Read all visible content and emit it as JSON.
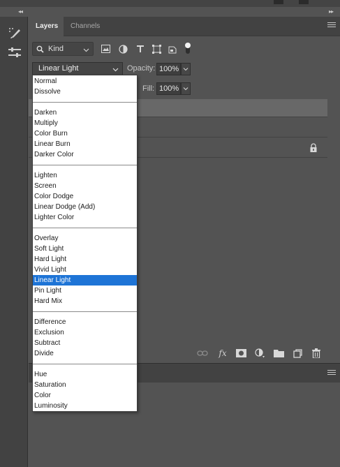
{
  "panel": {
    "tabs": [
      {
        "label": "Layers",
        "active": true
      },
      {
        "label": "Channels",
        "active": false
      }
    ]
  },
  "filter": {
    "kind_label": "Kind",
    "icons": [
      "pixel-filter-icon",
      "adjustment-filter-icon",
      "type-filter-icon",
      "shape-filter-icon",
      "smart-object-filter-icon",
      "filter-toggle-icon"
    ]
  },
  "blend": {
    "current_mode": "Linear Light",
    "opacity_label": "Opacity:",
    "opacity_value": "100%",
    "fill_label": "Fill:",
    "fill_value": "100%"
  },
  "blend_menu": {
    "groups": [
      [
        "Normal",
        "Dissolve"
      ],
      [
        "Darken",
        "Multiply",
        "Color Burn",
        "Linear Burn",
        "Darker Color"
      ],
      [
        "Lighten",
        "Screen",
        "Color Dodge",
        "Linear Dodge (Add)",
        "Lighter Color"
      ],
      [
        "Overlay",
        "Soft Light",
        "Hard Light",
        "Vivid Light",
        "Linear Light",
        "Pin Light",
        "Hard Mix"
      ],
      [
        "Difference",
        "Exclusion",
        "Subtract",
        "Divide"
      ],
      [
        "Hue",
        "Saturation",
        "Color",
        "Luminosity"
      ]
    ],
    "selected": "Linear Light"
  },
  "bottom_icons": [
    "link-layers-icon",
    "fx-icon",
    "add-mask-icon",
    "new-adjustment-layer-icon",
    "new-group-icon",
    "new-layer-icon",
    "delete-layer-icon"
  ],
  "colors": {
    "panel_bg": "#535353",
    "tab_bar_bg": "#424242",
    "selected_item": "#1e74d6",
    "menu_bg": "#ffffff"
  }
}
